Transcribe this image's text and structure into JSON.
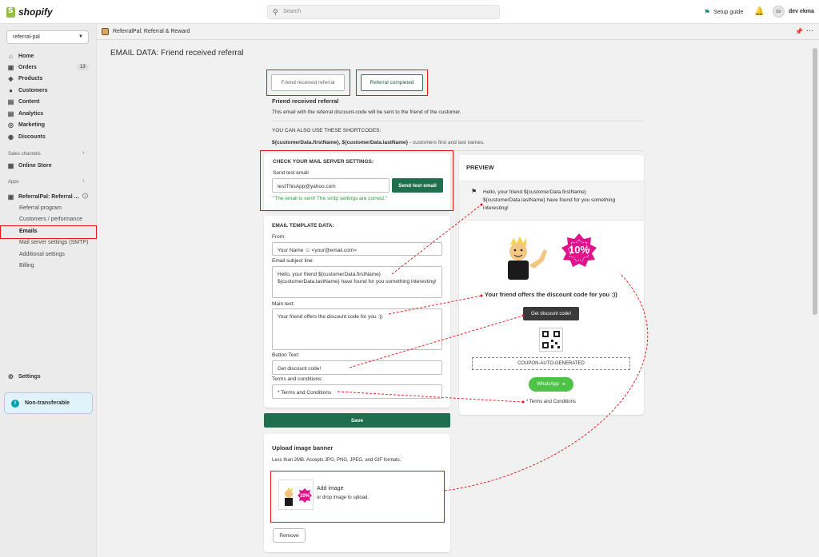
{
  "topbar": {
    "brand": "shopify",
    "search_placeholder": "Search",
    "setup_guide": "Setup guide",
    "avatar_initials": "de",
    "user_name": "dev ekma"
  },
  "sidebar": {
    "store": "referral-pal",
    "items": [
      {
        "label": "Home",
        "icon": "home-icon"
      },
      {
        "label": "Orders",
        "icon": "orders-icon",
        "badge": "13"
      },
      {
        "label": "Products",
        "icon": "tag-icon"
      },
      {
        "label": "Customers",
        "icon": "person-icon"
      },
      {
        "label": "Content",
        "icon": "content-icon"
      },
      {
        "label": "Analytics",
        "icon": "chart-icon"
      },
      {
        "label": "Marketing",
        "icon": "target-icon"
      },
      {
        "label": "Discounts",
        "icon": "discount-icon"
      }
    ],
    "sales_channels_label": "Sales channels",
    "online_store": "Online Store",
    "apps_label": "Apps",
    "app_name": "ReferralPal: Referral ...",
    "app_subitems": [
      "Referral program",
      "Customers / performance",
      "Emails",
      "Mail server settings (SMTP)",
      "Additional settings",
      "Billing"
    ],
    "settings": "Settings",
    "non_transferable": "Non-transferable"
  },
  "app_header": {
    "title": "ReferralPal: Referral & Reward"
  },
  "page": {
    "title": "EMAIL DATA: Friend received referral",
    "tabs": [
      "Friend received referral",
      "Referral completed"
    ],
    "section_title": "Friend received referral",
    "section_desc": "This email with the referral discount-code will be sent to the friend of the customer.",
    "shortcodes_title": "YOU CAN ALSO USE THESE SHORTCODES:",
    "shortcodes_codes": "${customerData.firstName}, ${customerData.lastName}",
    "shortcodes_desc": " - customers first and last names."
  },
  "mail_check": {
    "title": "CHECK YOUR MAIL SERVER SETTINGS:",
    "send_label": "Send test email",
    "email_value": "testThisApp@yahoo.com",
    "send_button": "Send test email",
    "success_msg": "\"The email is sent! The smtp settings are correct.\""
  },
  "template": {
    "title": "EMAIL TEMPLATE DATA:",
    "from_label": "From:",
    "from_value": "Your Name",
    "from_email": "<your@email.com>",
    "subject_label": "Email subject line:",
    "subject_value": "Hello, your friend ${customerData.firstName} ${customerData.lastName} have found for you something interesting!",
    "main_label": "Main text:",
    "main_value": "Your friend offers the discount code for you :))",
    "button_label": "Button Text:",
    "button_value": "Get discount code!",
    "terms_label": "Terms and conditions:",
    "terms_value": "* Terms and Conditions",
    "save_button": "Save"
  },
  "upload": {
    "title": "Upload image banner",
    "desc": "Less than 2MB. Accepts JPG, PNG, JPEG, and GIF formats.",
    "add_image": "Add image",
    "drop_hint": "or drop image to upload.",
    "remove_button": "Remove",
    "badge_text": "10%"
  },
  "preview": {
    "title": "PREVIEW",
    "subject": "Hello, your friend ${customerData.firstName} ${customerData.lastName} have found for you something interesting!",
    "badge_text": "10%",
    "main_text": "Your friend offers the discount code for you :))",
    "button": "Get discount code!",
    "coupon": "COUPON-AUTO-GENERATED",
    "whatsapp": "WhatsApp",
    "terms": "* Terms and Conditions"
  },
  "colors": {
    "accent_green": "#1f6e4e",
    "highlight_red": "#e11111",
    "badge_pink": "#e0138c",
    "whatsapp_green": "#4cc246"
  }
}
